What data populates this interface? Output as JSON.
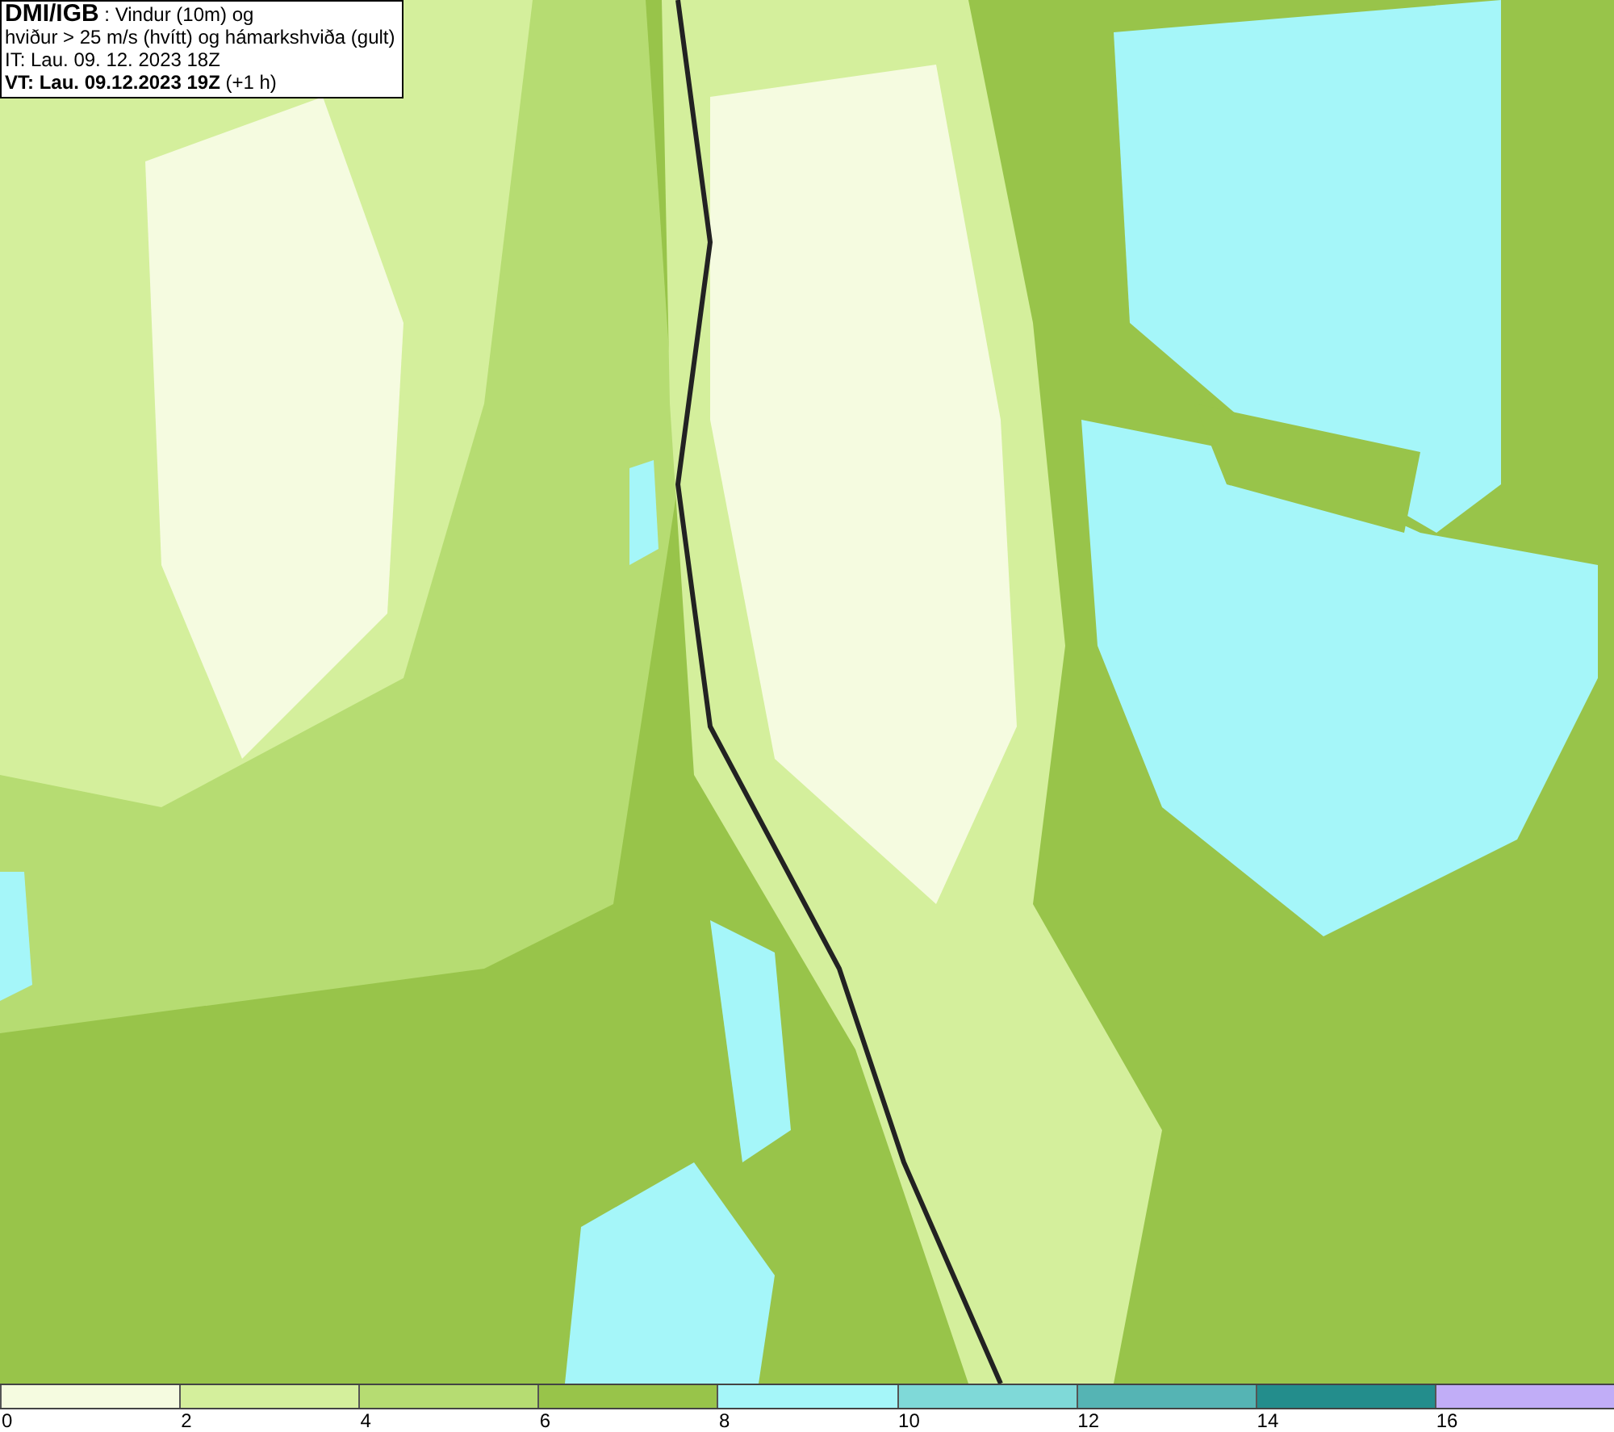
{
  "header": {
    "lines": [
      "**DMI/IGB** : Vindur (10m) og",
      "hviður > 25 m/s (hvítt) og hámarkshviða (gult)",
      "IT: Lau. 09. 12. 2023 18Z",
      "**VT: Lau. 09.12.2023 19Z** (+1 h)"
    ]
  },
  "legend": {
    "segments": [
      {
        "color": "#f5fbe0"
      },
      {
        "color": "#d4ef9c"
      },
      {
        "color": "#b6dc72"
      },
      {
        "color": "#98c44a"
      },
      {
        "color": "#a5f6f9"
      },
      {
        "color": "#7fd9d8"
      },
      {
        "color": "#55b4b4"
      },
      {
        "color": "#238d8c"
      },
      {
        "color": "#c1adf7"
      }
    ],
    "ticks": [
      "0",
      "2",
      "4",
      "6",
      "8",
      "10",
      "12",
      "14",
      "16"
    ]
  }
}
